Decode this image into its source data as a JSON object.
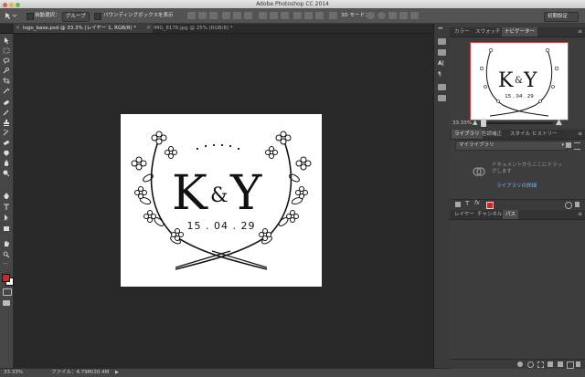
{
  "window": {
    "title": "Adobe Photoshop CC 2014"
  },
  "options_bar": {
    "auto_select_label": "自動選択：",
    "auto_select_value": "グループ",
    "transform_label": "バウンディングボックスを表示",
    "threed_mode_label": "3D モード：",
    "workspace": "初期設定"
  },
  "tabs": [
    {
      "label": "logo_base.psd @ 33.3% (レイヤー 1, RGB/8) *",
      "active": true
    },
    {
      "label": "IMG_8176.jpg @ 25% (RGB/8) *",
      "active": false
    }
  ],
  "status": {
    "zoom": "33.33%",
    "file": "ファイル：4.79M/20.4M"
  },
  "navigator": {
    "tabs": [
      "カラー",
      "スウォッチ",
      "ナビゲーター"
    ],
    "zoom": "33.33%"
  },
  "libraries": {
    "tabs": [
      "ライブラリ",
      "色調補正",
      "スタイル",
      "ヒストリー"
    ],
    "selected": "マイライブラリ",
    "message": "ドキュメントからここにドラッグします",
    "link": "ライブラリの詳細"
  },
  "layers": {
    "tabs": [
      "レイヤー",
      "チャンネル",
      "パス"
    ]
  },
  "artwork": {
    "monogram_left": "K",
    "monogram_amp": "&",
    "monogram_right": "Y",
    "date": "15 . 04 . 29"
  },
  "colors": {
    "foreground": "#e02020",
    "background": "#ffffff",
    "nav_frame": "#d94040",
    "link": "#7fb3ea"
  },
  "icons": [
    "move-tool-icon",
    "marquee-tool-icon",
    "lasso-tool-icon",
    "quick-select-icon",
    "crop-tool-icon",
    "eyedropper-icon",
    "healing-brush-icon",
    "brush-tool-icon",
    "clone-stamp-icon",
    "history-brush-icon",
    "eraser-icon",
    "gradient-icon",
    "blur-icon",
    "dodge-icon",
    "pen-tool-icon",
    "type-tool-icon",
    "path-select-icon",
    "rectangle-tool-icon",
    "hand-tool-icon",
    "zoom-tool-icon"
  ]
}
